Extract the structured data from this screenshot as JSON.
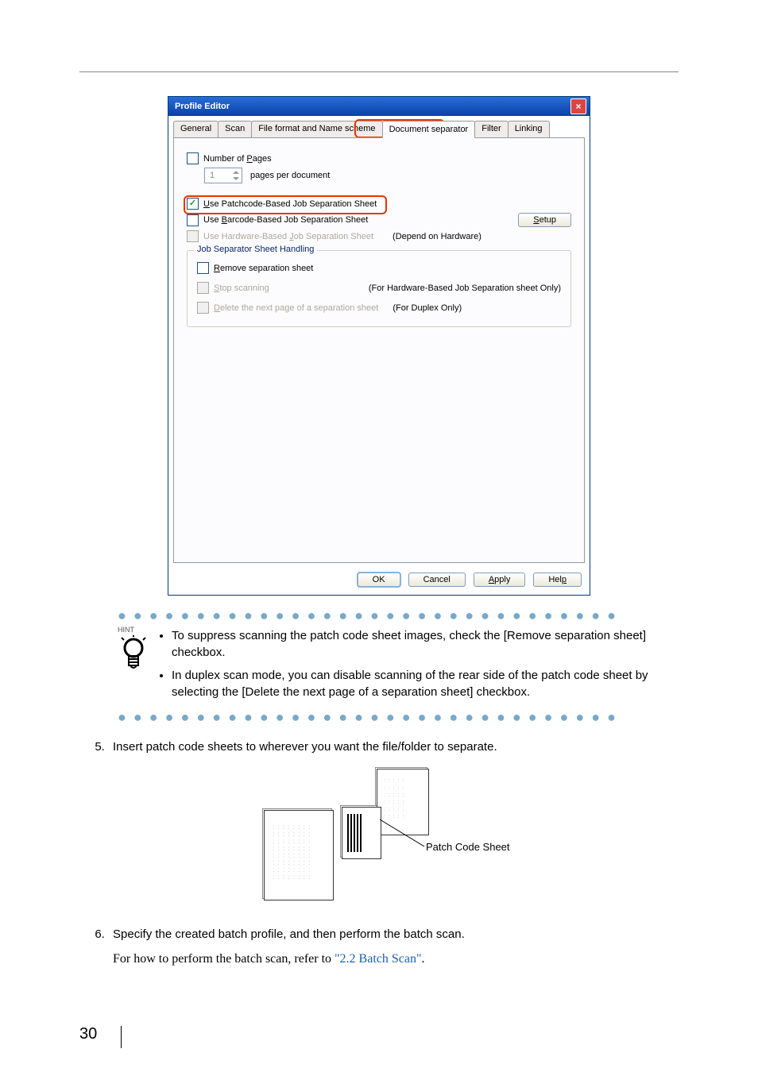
{
  "dialog": {
    "title": "Profile Editor",
    "tabs": {
      "general": "General",
      "scan": "Scan",
      "file": "File format and Name scheme",
      "docsep": "Document separator",
      "filter": "Filter",
      "linking": "Linking"
    },
    "numPagesLabelPre": "Number of ",
    "numPagesLabelU": "P",
    "numPagesLabelPost": "ages",
    "numPagesValue": "1",
    "pagesPerDoc": "pages per document",
    "usePatchPre": "",
    "usePatchU": "U",
    "usePatchPost": "se Patchcode-Based Job Separation Sheet",
    "useBarPre": "Use ",
    "useBarU": "B",
    "useBarPost": "arcode-Based Job Separation Sheet",
    "useHwPre": "Use Hardware-Based ",
    "useHwU": "J",
    "useHwPost": "ob Separation Sheet",
    "hwNote": "(Depend on Hardware)",
    "setupU": "S",
    "setupPost": "etup",
    "groupTitle": "Job Separator Sheet Handling",
    "removeU": "R",
    "removePost": "emove separation sheet",
    "stopU": "S",
    "stopPost": "top scanning",
    "stopNote": "(For Hardware-Based Job Separation sheet Only)",
    "delU": "D",
    "delPost": "elete the next page of a separation sheet",
    "delNote": "(For Duplex Only)",
    "ok": "OK",
    "cancel": "Cancel",
    "applyU": "A",
    "applyPost": "pply",
    "helpPost": "p",
    "helpPre": "Hel"
  },
  "hint": {
    "label": "HINT",
    "b1": "To suppress scanning the patch code sheet images, check the [Remove separation sheet] checkbox.",
    "b2": "In duplex scan mode, you can disable scanning of the rear side of the patch code sheet by selecting the [Delete the next page of a separation sheet] checkbox."
  },
  "step5": "Insert patch code sheets to wherever you want the file/folder to separate.",
  "patchLabel": "Patch Code Sheet",
  "step6": "Specify the created batch profile, and then perform the batch scan.",
  "step6ref_pre": "For how to perform the batch scan, refer to ",
  "step6ref_link": "\"2.2  Batch Scan\"",
  "step6ref_post": ".",
  "pageNumber": "30"
}
